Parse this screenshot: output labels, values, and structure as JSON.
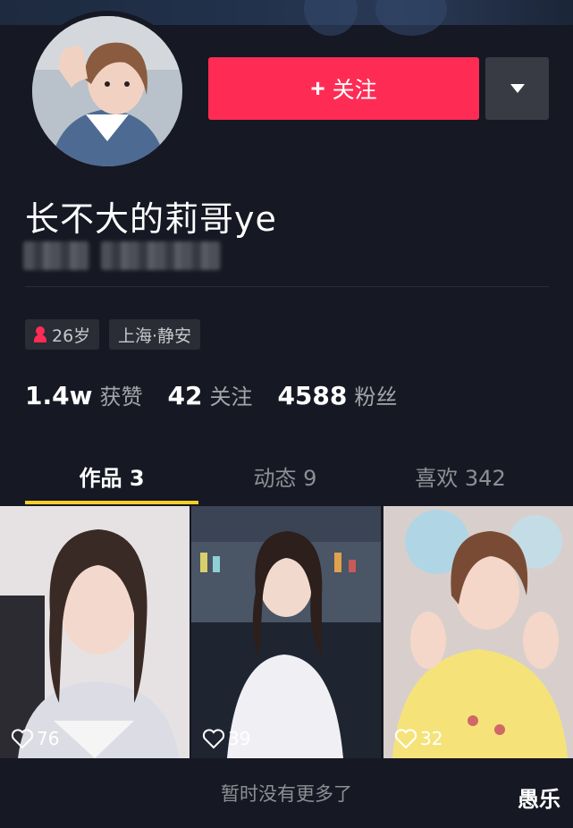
{
  "profile": {
    "nickname": "长不大的莉哥ye",
    "follow_label": "关注",
    "follow_icon": "plus-icon",
    "more_icon": "caret-down-icon"
  },
  "tags": {
    "age": "26岁",
    "location": "上海·静安"
  },
  "stats": {
    "likes_count": "1.4w",
    "likes_label": "获赞",
    "following_count": "42",
    "following_label": "关注",
    "followers_count": "4588",
    "followers_label": "粉丝"
  },
  "tabs": [
    {
      "label": "作品 3",
      "active": true
    },
    {
      "label": "动态 9",
      "active": false
    },
    {
      "label": "喜欢 342",
      "active": false
    }
  ],
  "videos": [
    {
      "likes": "76"
    },
    {
      "likes": "39"
    },
    {
      "likes": "32"
    }
  ],
  "footer": {
    "no_more": "暂时没有更多了",
    "watermark": "愚乐"
  },
  "colors": {
    "background": "#161823",
    "accent": "#fe2c55",
    "tab_indicator": "#facf26"
  }
}
